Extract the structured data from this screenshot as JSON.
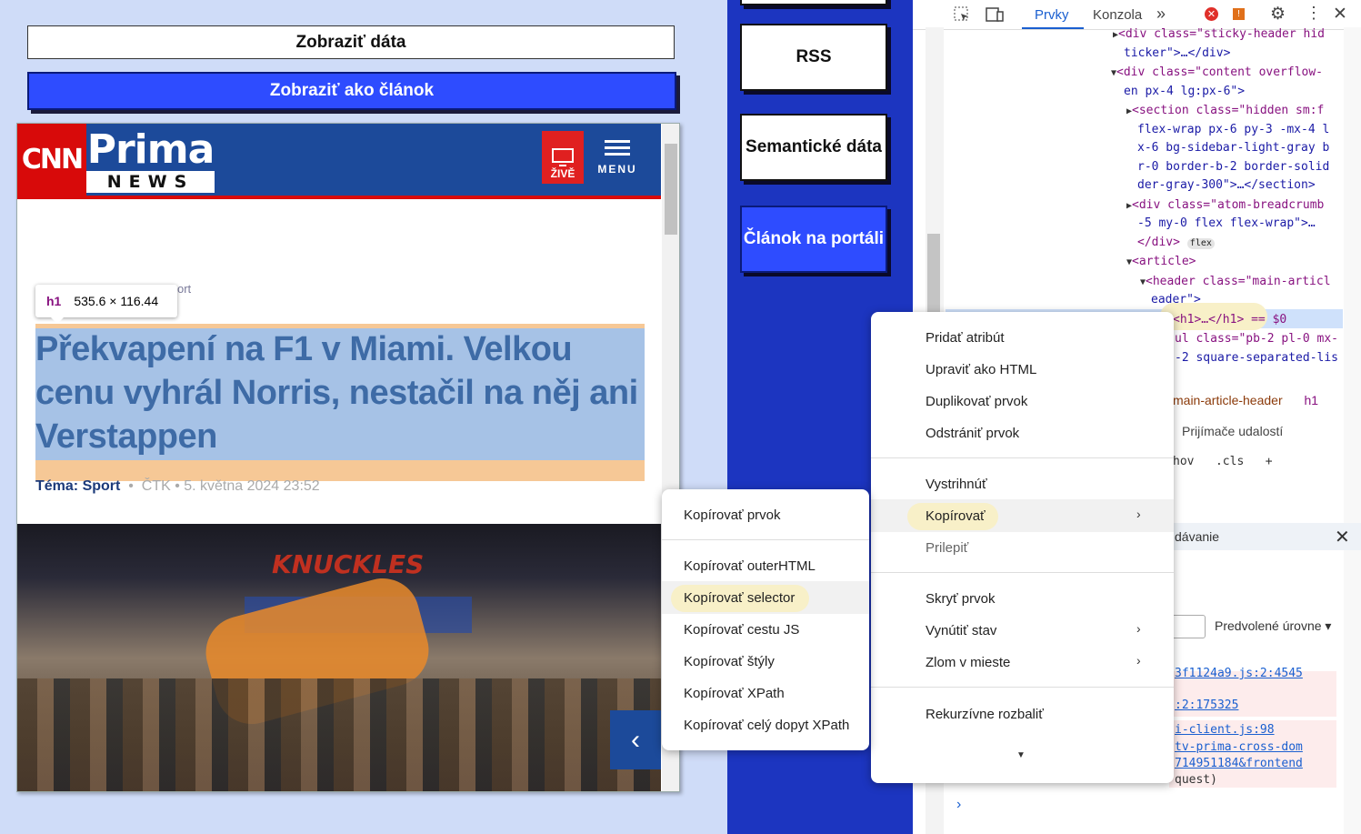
{
  "left": {
    "show_data_label": "Zobraziť dáta",
    "show_article_label": "Zobraziť ako článok"
  },
  "site": {
    "cnn_logo": "CNN",
    "prima_logo": "Prima",
    "news_logo": "NEWS",
    "live_label": "ŽIVĚ",
    "menu_label": "MENU",
    "breadcrumb_fragment": "ort",
    "tooltip_tag": "h1",
    "tooltip_size": "535.6 × 116.44",
    "headline": "Překvapení na F1 v Miami. Velkou cenu vyhrál Norris, nestačil na něj ani Verstappen",
    "topic": "Téma: Sport",
    "source": "ČTK",
    "date": "5. května 2024 23:52",
    "photo_banner": "KNUCKLES",
    "prev_icon": "‹"
  },
  "middle": {
    "rss": "RSS",
    "semantic": "Semantické dáta",
    "portal": "Článok na portáli"
  },
  "devtools": {
    "tab_elements": "Prvky",
    "tab_console": "Konzola",
    "more_tabs": "»",
    "code_lines": [
      "<div class=\"sticky-header hid",
      "ticker\">…</div>",
      "<div class=\"content overflow-",
      "en px-4 lg:px-6\">",
      "<section class=\"hidden sm:f",
      "flex-wrap px-6 py-3 -mx-4 l",
      "x-6 bg-sidebar-light-gray b",
      "r-0 border-b-2 border-solid",
      "der-gray-300\">…</section>",
      "<div class=\"atom-breadcrumb",
      "-5 my-0 flex flex-wrap\">…",
      "</div>",
      "<article>",
      "<header class=\"main-articl",
      "eader\">",
      "<h1>…</h1> == $0",
      "ul class=\"pb-2 pl-0 mx-",
      "-2 square-separated-lis"
    ],
    "flex_badge": "flex",
    "crumb_header": "main-article-header",
    "crumb_h1": "h1",
    "event_listeners": "Prijímače udalostí",
    "styles_hov": "hov",
    "styles_cls": ".cls",
    "issues_label": "dávanie",
    "levels_label": "Predvolené úrovne",
    "console_lines": [
      "3f1124a9.js:2:4545",
      ":2:175325",
      "i-client.js:98",
      "tv-prima-cross-dom",
      "714951184&frontend",
      "quest)"
    ]
  },
  "context_menu": {
    "items": [
      "Pridať atribút",
      "Upraviť ako HTML",
      "Duplikovať prvok",
      "Odstrániť prvok",
      "Vystrihnúť",
      "Kopírovať",
      "Prilepiť",
      "Skryť prvok",
      "Vynútiť stav",
      "Zlom v mieste",
      "Rekurzívne rozbaliť"
    ]
  },
  "copy_submenu": {
    "items": [
      "Kopírovať prvok",
      "Kopírovať outerHTML",
      "Kopírovať selector",
      "Kopírovať cestu JS",
      "Kopírovať štýly",
      "Kopírovať XPath",
      "Kopírovať celý dopyt XPath"
    ]
  }
}
